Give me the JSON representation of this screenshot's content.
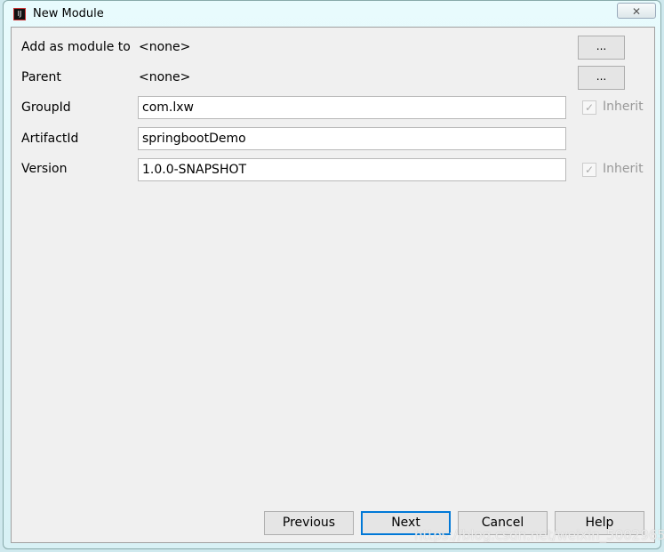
{
  "window": {
    "title": "New Module",
    "close_icon": "close-icon"
  },
  "form": {
    "add_as_module_to": {
      "label": "Add as module to",
      "value": "<none>",
      "button": "..."
    },
    "parent": {
      "label": "Parent",
      "value": "<none>",
      "button": "..."
    },
    "group_id": {
      "label": "GroupId",
      "value": "com.lxw",
      "inherit_label": "Inherit",
      "inherit_checked": true
    },
    "artifact_id": {
      "label": "ArtifactId",
      "value": "springbootDemo"
    },
    "version": {
      "label": "Version",
      "value": "1.0.0-SNAPSHOT",
      "inherit_label": "Inherit",
      "inherit_checked": true
    }
  },
  "buttons": {
    "previous": "Previous",
    "next": "Next",
    "cancel": "Cancel",
    "help": "Help"
  },
  "watermark": "https://blog.csdn.net/weixin_50029657"
}
